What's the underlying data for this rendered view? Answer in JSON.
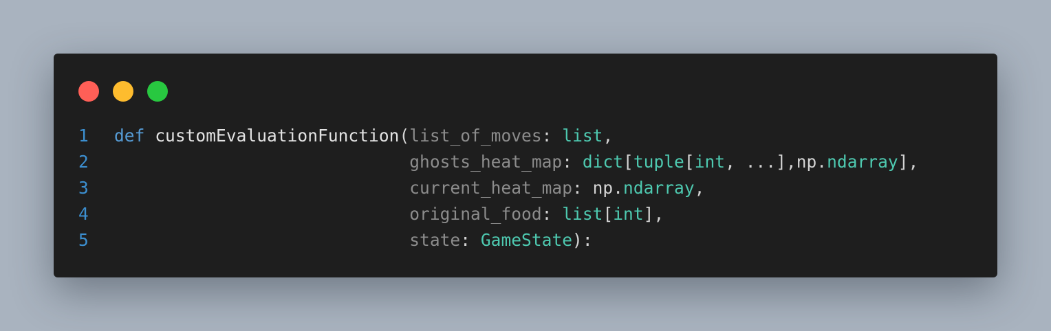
{
  "window": {
    "dots": [
      {
        "name": "close",
        "color": "#ff5f57"
      },
      {
        "name": "minimize",
        "color": "#febc2e"
      },
      {
        "name": "maximize",
        "color": "#28c840"
      }
    ]
  },
  "code": {
    "lines": [
      {
        "number": "1",
        "tokens": [
          {
            "t": "def",
            "c": "kw"
          },
          {
            "t": " ",
            "c": "plain"
          },
          {
            "t": "customEvaluationFunction",
            "c": "fn"
          },
          {
            "t": "(",
            "c": "punct"
          },
          {
            "t": "list_of_moves",
            "c": "param"
          },
          {
            "t": ": ",
            "c": "punct"
          },
          {
            "t": "list",
            "c": "type"
          },
          {
            "t": ",",
            "c": "punct"
          }
        ]
      },
      {
        "number": "2",
        "tokens": [
          {
            "t": "                             ",
            "c": "plain"
          },
          {
            "t": "ghosts_heat_map",
            "c": "param"
          },
          {
            "t": ": ",
            "c": "punct"
          },
          {
            "t": "dict",
            "c": "type"
          },
          {
            "t": "[",
            "c": "punct"
          },
          {
            "t": "tuple",
            "c": "type"
          },
          {
            "t": "[",
            "c": "punct"
          },
          {
            "t": "int",
            "c": "type"
          },
          {
            "t": ", ...],np.",
            "c": "punct"
          },
          {
            "t": "ndarray",
            "c": "type"
          },
          {
            "t": "],",
            "c": "punct"
          }
        ]
      },
      {
        "number": "3",
        "tokens": [
          {
            "t": "                             ",
            "c": "plain"
          },
          {
            "t": "current_heat_map",
            "c": "param"
          },
          {
            "t": ": np.",
            "c": "punct"
          },
          {
            "t": "ndarray",
            "c": "type"
          },
          {
            "t": ",",
            "c": "punct"
          }
        ]
      },
      {
        "number": "4",
        "tokens": [
          {
            "t": "                             ",
            "c": "plain"
          },
          {
            "t": "original_food",
            "c": "param"
          },
          {
            "t": ": ",
            "c": "punct"
          },
          {
            "t": "list",
            "c": "type"
          },
          {
            "t": "[",
            "c": "punct"
          },
          {
            "t": "int",
            "c": "type"
          },
          {
            "t": "],",
            "c": "punct"
          }
        ]
      },
      {
        "number": "5",
        "tokens": [
          {
            "t": "                             ",
            "c": "plain"
          },
          {
            "t": "state",
            "c": "param"
          },
          {
            "t": ": ",
            "c": "punct"
          },
          {
            "t": "GameState",
            "c": "type"
          },
          {
            "t": "):",
            "c": "punct"
          }
        ]
      }
    ]
  }
}
